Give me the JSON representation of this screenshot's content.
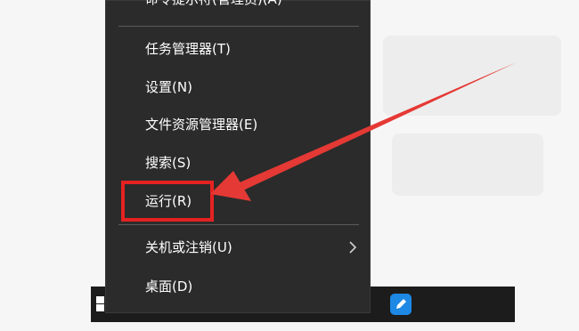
{
  "menu": {
    "items": [
      {
        "label": "命令提示符(管理员)(A)"
      },
      {
        "label": "任务管理器(T)"
      },
      {
        "label": "设置(N)"
      },
      {
        "label": "文件资源管理器(E)"
      },
      {
        "label": "搜索(S)"
      },
      {
        "label": "运行(R)"
      },
      {
        "label": "关机或注销(U)",
        "icon": "chevron-right-icon"
      },
      {
        "label": "桌面(D)"
      }
    ]
  },
  "taskbar": {
    "start_icon": "windows-logo-icon",
    "app_icon": "pen-app-icon"
  },
  "annotation": {
    "highlight_color": "#e52222",
    "arrow_color": "#e53935"
  }
}
